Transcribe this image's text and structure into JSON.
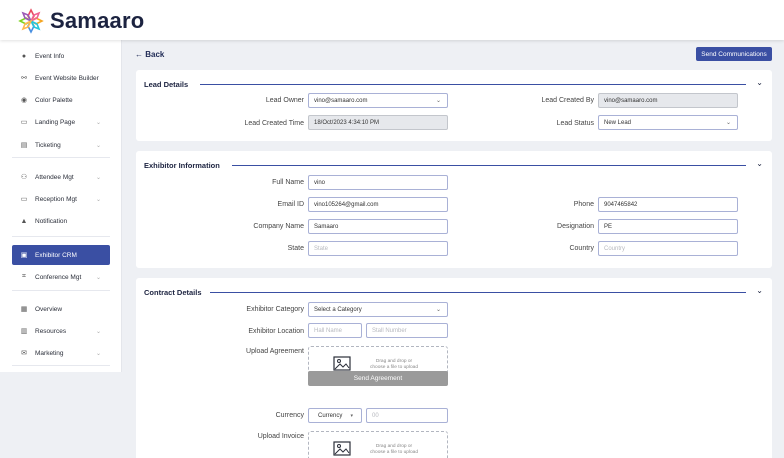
{
  "app": {
    "name": "Samaaro"
  },
  "sidebar": {
    "items": [
      {
        "icon": "info-icon",
        "glyph": "●",
        "label": "Event Info",
        "chevron": false
      },
      {
        "icon": "builder-icon",
        "glyph": "⚯",
        "label": "Event Website Builder",
        "chevron": false
      },
      {
        "icon": "palette-icon",
        "glyph": "◉",
        "label": "Color Palette",
        "chevron": false
      },
      {
        "icon": "landing-page-icon",
        "glyph": "▭",
        "label": "Landing Page",
        "chevron": true
      },
      {
        "icon": "ticket-icon",
        "glyph": "▤",
        "label": "Ticketing",
        "chevron": true
      },
      {
        "icon": "attendee-icon",
        "glyph": "⚇",
        "label": "Attendee Mgt",
        "chevron": true
      },
      {
        "icon": "reception-icon",
        "glyph": "▭",
        "label": "Reception Mgt",
        "chevron": true
      },
      {
        "icon": "bell-icon",
        "glyph": "▲",
        "label": "Notification",
        "chevron": false
      },
      {
        "icon": "crm-icon",
        "glyph": "▣",
        "label": "Exhibitor CRM",
        "chevron": false,
        "active": true
      },
      {
        "icon": "conference-icon",
        "glyph": "⌗",
        "label": "Conference Mgt",
        "chevron": true
      },
      {
        "icon": "overview-icon",
        "glyph": "▦",
        "label": "Overview",
        "chevron": false
      },
      {
        "icon": "resources-icon",
        "glyph": "▥",
        "label": "Resources",
        "chevron": true
      },
      {
        "icon": "marketing-icon",
        "glyph": "✉",
        "label": "Marketing",
        "chevron": true
      }
    ]
  },
  "header": {
    "back_label": "← Back",
    "send_communications": "Send Communications"
  },
  "lead_details": {
    "title": "Lead Details",
    "lead_owner_label": "Lead Owner",
    "lead_owner_value": "vino@samaaro.com",
    "lead_created_by_label": "Lead Created By",
    "lead_created_by_value": "vino@samaaro.com",
    "lead_created_time_label": "Lead Created Time",
    "lead_created_time_value": "18/Oct/2023  4:34:10 PM",
    "lead_status_label": "Lead Status",
    "lead_status_value": "New Lead"
  },
  "exhibitor_info": {
    "title": "Exhibitor Information",
    "full_name_label": "Full Name",
    "full_name_value": "vino",
    "email_label": "Email ID",
    "email_value": "vino105264@gmail.com",
    "phone_label": "Phone",
    "phone_value": "9047465842",
    "company_label": "Company Name",
    "company_value": "Samaaro",
    "designation_label": "Designation",
    "designation_value": "PE",
    "state_label": "State",
    "state_placeholder": "State",
    "country_label": "Country",
    "country_placeholder": "Country"
  },
  "contract_details": {
    "title": "Contract Details",
    "category_label": "Exhibitor Category",
    "category_value": "Select a Category",
    "location_label": "Exhibitor Location",
    "hall_placeholder": "Hall Name",
    "stall_placeholder": "Stall Number",
    "upload_agreement_label": "Upload Agreement",
    "upload_text_1": "Drag and drop or",
    "upload_text_2": "choose a file to upload",
    "send_agreement": "Send Agreement",
    "currency_label": "Currency",
    "currency_value": "Currency",
    "amount_placeholder": "00",
    "upload_invoice_label": "Upload Invoice"
  },
  "colors": {
    "primary": "#3a4fa3",
    "brand_text": "#1c2340",
    "background": "#eef0f4"
  }
}
